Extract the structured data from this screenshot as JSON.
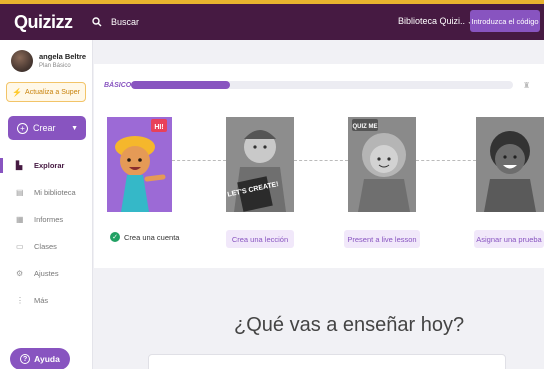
{
  "header": {
    "logo": "Quizizz",
    "search_placeholder": "Buscar",
    "library_label": "Biblioteca Quizi..",
    "code_button": "Introduzca el código"
  },
  "sidebar": {
    "user_name": "angela Beltre",
    "user_plan": "Plan Básico",
    "upgrade_label": "Actualiza a Super",
    "create_label": "Crear",
    "items": [
      {
        "label": "Explorar",
        "icon": "explore-icon"
      },
      {
        "label": "Mi biblioteca",
        "icon": "library-icon"
      },
      {
        "label": "Informes",
        "icon": "reports-icon"
      },
      {
        "label": "Clases",
        "icon": "classes-icon"
      },
      {
        "label": "Ajustes",
        "icon": "settings-icon"
      },
      {
        "label": "Más",
        "icon": "more-icon"
      }
    ],
    "help_label": "Ayuda"
  },
  "onboarding": {
    "level_label": "BÁSICO",
    "progress": 0.26,
    "steps": [
      {
        "label": "Crea una cuenta",
        "completed": true,
        "tile_text": "HI!"
      },
      {
        "label": "Crea una lección",
        "completed": false,
        "tile_text": "LET'S CREATE!"
      },
      {
        "label": "Present a live lesson",
        "completed": false,
        "tile_text": "QUIZ ME"
      },
      {
        "label": "Asignar una prueba",
        "completed": false,
        "tile_text": ""
      }
    ]
  },
  "main": {
    "question": "¿Qué vas a enseñar hoy?"
  },
  "colors": {
    "topbar": "#461a42",
    "accent": "#8854c0",
    "success": "#21a063"
  }
}
